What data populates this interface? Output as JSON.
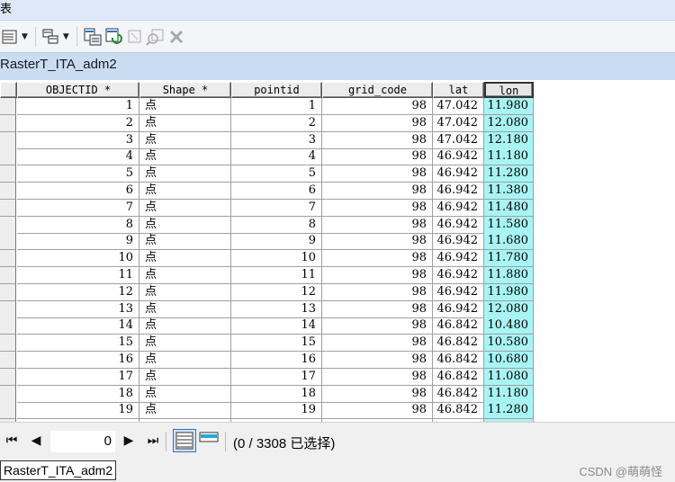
{
  "window": {
    "title_fragment": "表"
  },
  "toolbar": {
    "icons": [
      "table-options-icon",
      "related-tables-icon",
      "select-by-attributes-icon",
      "switch-selection-icon",
      "clear-selection-icon",
      "zoom-to-selected-icon",
      "delete-selected-icon"
    ]
  },
  "tab": {
    "name": "RasterT_ITA_adm2"
  },
  "table": {
    "columns": [
      "OBJECTID *",
      "Shape *",
      "pointid",
      "grid_code",
      "lat",
      "lon"
    ],
    "selected_column": "lon",
    "highlight_color": "#a8f4f4",
    "rows": [
      [
        "1",
        "点",
        "1",
        "98",
        "47.042",
        "11.980"
      ],
      [
        "2",
        "点",
        "2",
        "98",
        "47.042",
        "12.080"
      ],
      [
        "3",
        "点",
        "3",
        "98",
        "47.042",
        "12.180"
      ],
      [
        "4",
        "点",
        "4",
        "98",
        "46.942",
        "11.180"
      ],
      [
        "5",
        "点",
        "5",
        "98",
        "46.942",
        "11.280"
      ],
      [
        "6",
        "点",
        "6",
        "98",
        "46.942",
        "11.380"
      ],
      [
        "7",
        "点",
        "7",
        "98",
        "46.942",
        "11.480"
      ],
      [
        "8",
        "点",
        "8",
        "98",
        "46.942",
        "11.580"
      ],
      [
        "9",
        "点",
        "9",
        "98",
        "46.942",
        "11.680"
      ],
      [
        "10",
        "点",
        "10",
        "98",
        "46.942",
        "11.780"
      ],
      [
        "11",
        "点",
        "11",
        "98",
        "46.942",
        "11.880"
      ],
      [
        "12",
        "点",
        "12",
        "98",
        "46.942",
        "11.980"
      ],
      [
        "13",
        "点",
        "13",
        "98",
        "46.942",
        "12.080"
      ],
      [
        "14",
        "点",
        "14",
        "98",
        "46.842",
        "10.480"
      ],
      [
        "15",
        "点",
        "15",
        "98",
        "46.842",
        "10.580"
      ],
      [
        "16",
        "点",
        "16",
        "98",
        "46.842",
        "10.680"
      ],
      [
        "17",
        "点",
        "17",
        "98",
        "46.842",
        "11.080"
      ],
      [
        "18",
        "点",
        "18",
        "98",
        "46.842",
        "11.180"
      ],
      [
        "19",
        "点",
        "19",
        "98",
        "46.842",
        "11.280"
      ]
    ]
  },
  "navigation": {
    "current_record": "0",
    "status": "(0 / 3308 已选择)"
  },
  "bottom_tab": {
    "name": "RasterT_ITA_adm2"
  },
  "watermark": "CSDN @萌萌怪"
}
